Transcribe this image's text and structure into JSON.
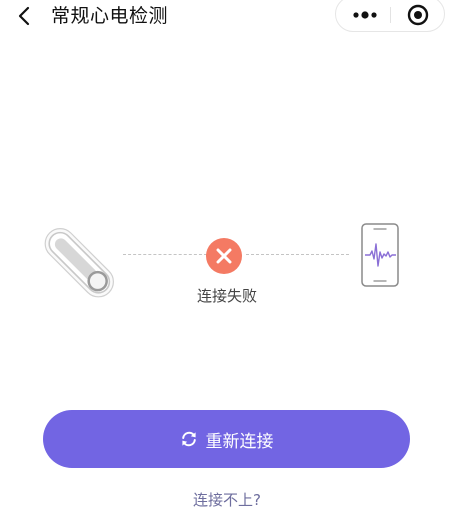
{
  "header": {
    "title": "常规心电检测",
    "back_icon": "chevron-left-icon",
    "more_icon": "more-dots-icon",
    "close_icon": "target-close-icon"
  },
  "connection": {
    "device_icon": "ecg-device-icon",
    "status_icon": "error-x-icon",
    "status_color": "#f47a63",
    "status_text": "连接失败",
    "phone_icon": "phone-waveform-icon"
  },
  "actions": {
    "reconnect_label": "重新连接",
    "reconnect_color": "#7265e3",
    "refresh_icon": "refresh-icon",
    "help_link": "连接不上?"
  }
}
